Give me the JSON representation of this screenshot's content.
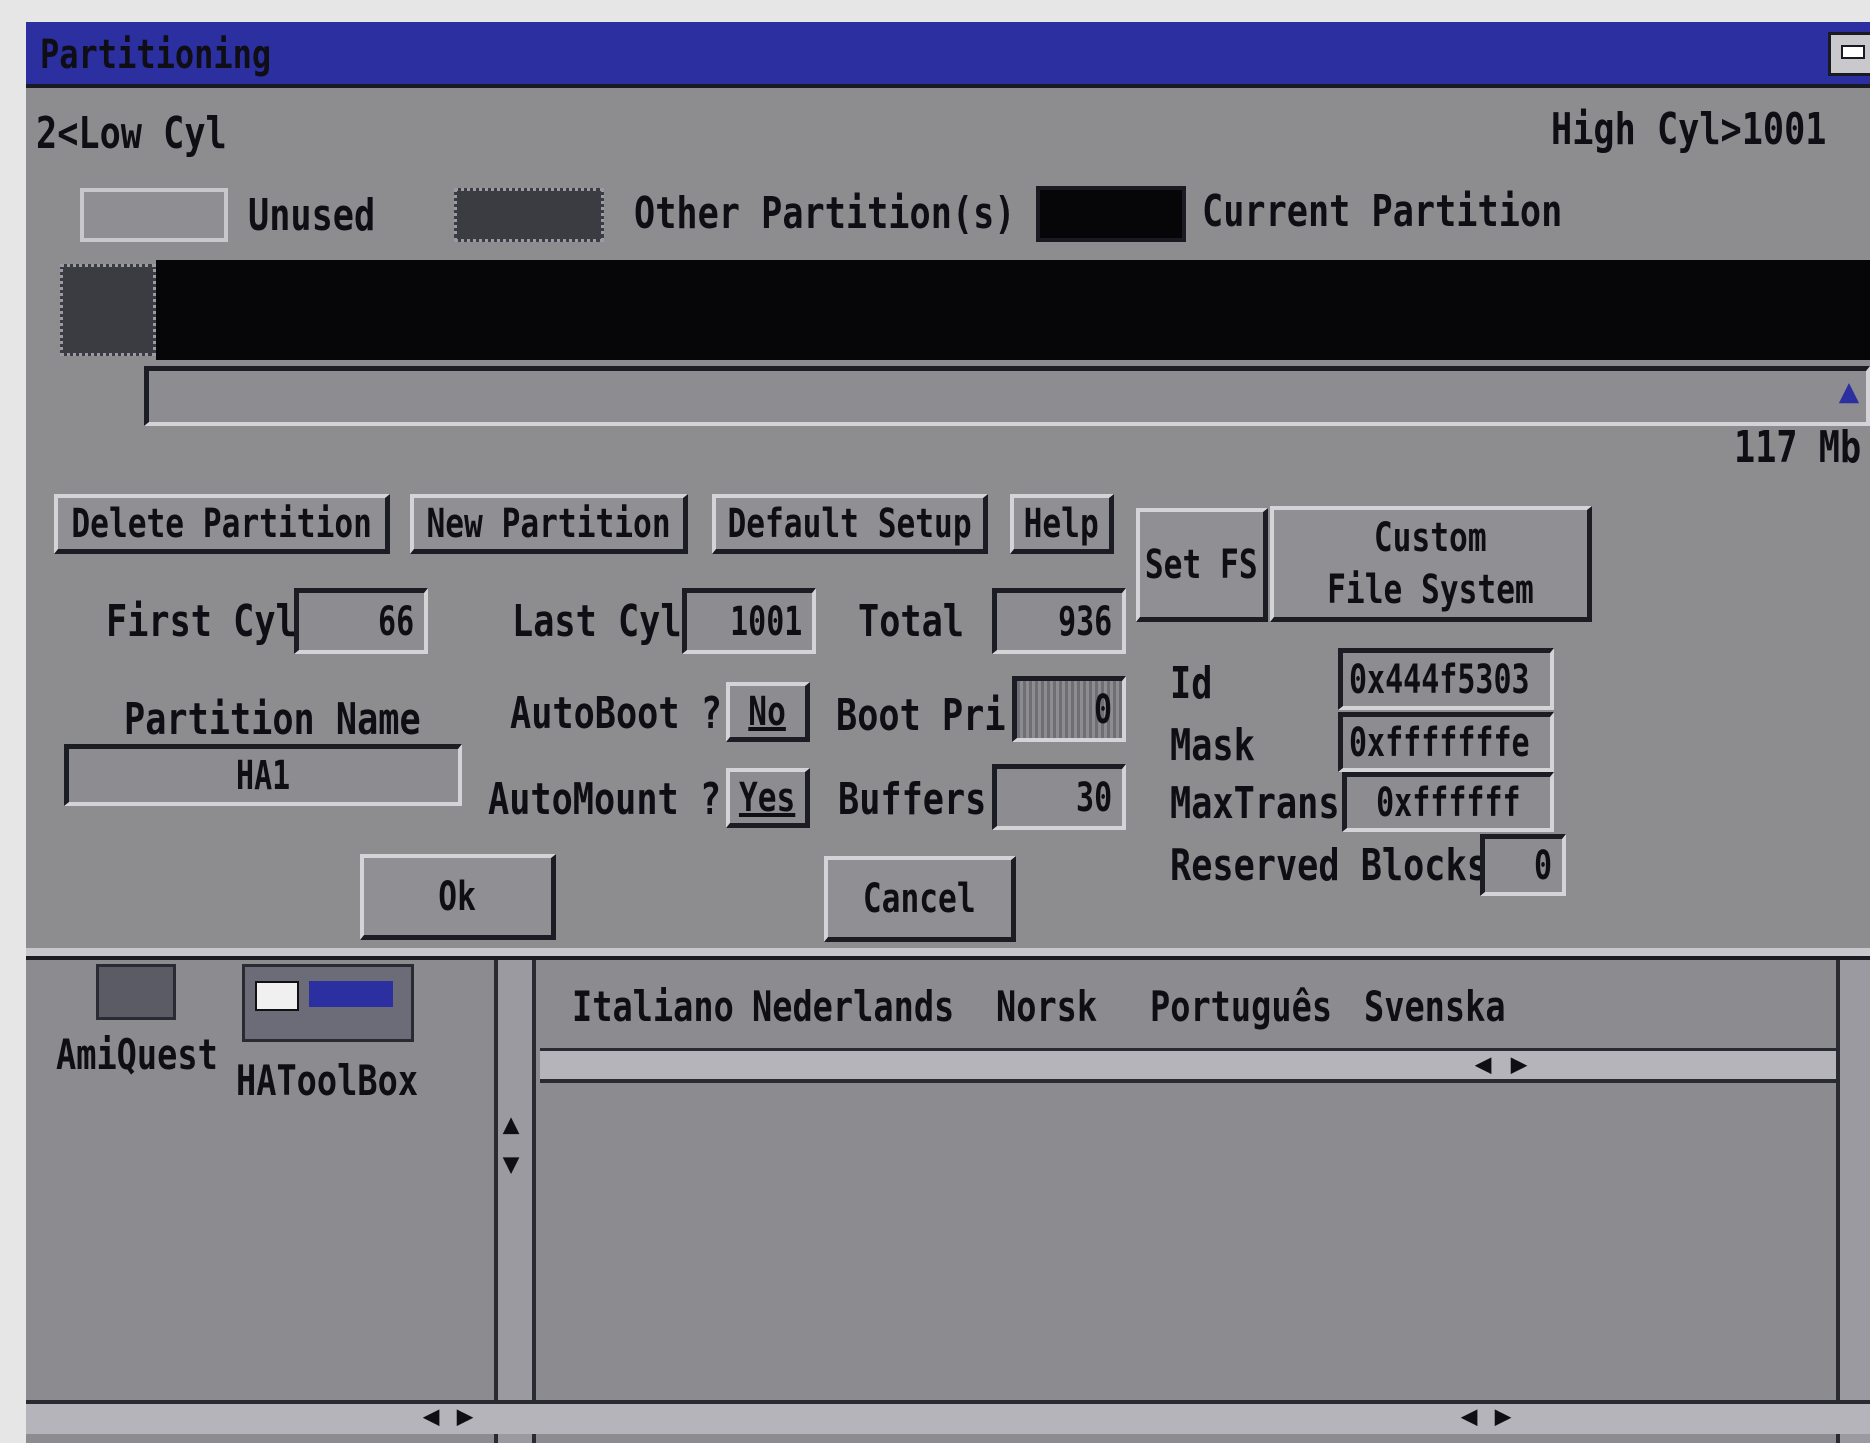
{
  "window": {
    "title": "Partitioning"
  },
  "cylinder_range": {
    "low": "2<Low Cyl",
    "high": "High Cyl>1001"
  },
  "legend": {
    "unused": "Unused",
    "other": "Other Partition(s)",
    "current": "Current Partition"
  },
  "disk_size": "117 Mb",
  "buttons": {
    "delete": "Delete Partition",
    "new": "New Partition",
    "default": "Default Setup",
    "help": "Help",
    "set_fs": "Set FS",
    "custom_fs_line1": "Custom",
    "custom_fs_line2": "File System",
    "ok": "Ok",
    "cancel": "Cancel"
  },
  "fields": {
    "first_cyl_label": "First Cyl",
    "first_cyl": "66",
    "last_cyl_label": "Last Cyl",
    "last_cyl": "1001",
    "total_label": "Total",
    "total": "936",
    "partition_name_label": "Partition Name",
    "partition_name": "HA1",
    "autoboot_label": "AutoBoot ?",
    "autoboot": "No",
    "automount_label": "AutoMount ?",
    "automount": "Yes",
    "boot_pri_label": "Boot Pri",
    "boot_pri": "0",
    "buffers_label": "Buffers",
    "buffers": "30",
    "id_label": "Id",
    "id": "0x444f5303",
    "mask_label": "Mask",
    "mask": "0xfffffffe",
    "maxtrans_label": "MaxTrans",
    "maxtrans": "0xffffff",
    "reserved_label": "Reserved Blocks",
    "reserved": "0"
  },
  "background": {
    "icons": [
      "AmiQuest",
      "HAToolBox"
    ],
    "languages": [
      "Italiano",
      "Nederlands",
      "Norsk",
      "Português",
      "Svenska"
    ]
  },
  "colors": {
    "screen_bg": "#8d8d8f",
    "title_bar": "#2c2fa0",
    "current_partition": "#060608",
    "other_partition": "#3b3b42"
  }
}
